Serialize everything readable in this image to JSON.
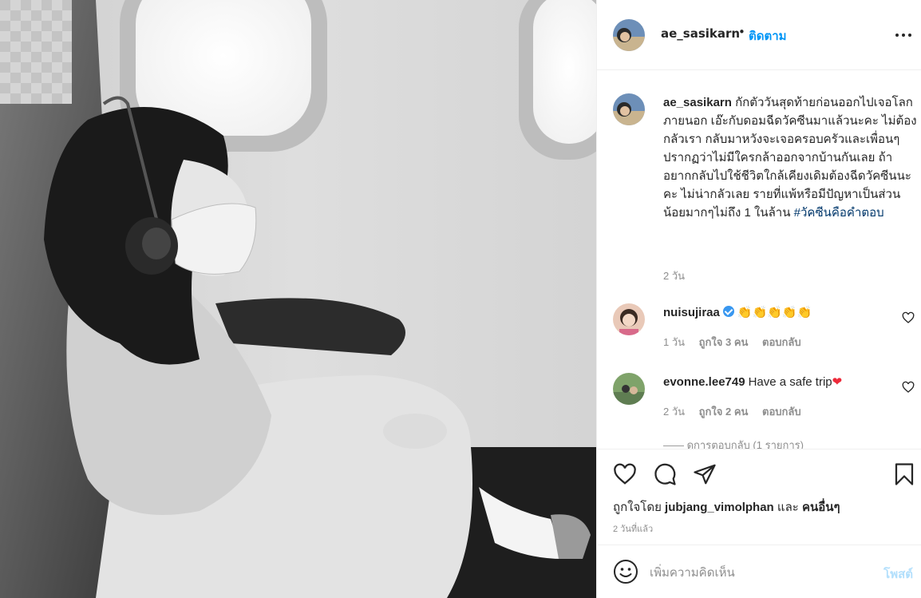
{
  "post": {
    "photo_icon": "airplane-photo",
    "author": {
      "username": "ae_sasikarn",
      "follow_label": "ติดตาม",
      "separator": "•"
    },
    "caption": {
      "username": "ae_sasikarn",
      "text": "กักตัววันสุดท้ายก่อนออกไปเจอโลกภายนอก เอ๊ะกับดอมฉีดวัคซีนมาแล้วนะคะ ไม่ต้องกลัวเรา กลับมาหวังจะเจอครอบครัวและเพื่อนๆ ปรากฏว่าไม่มีใครกล้าออกจากบ้านกันเลย ถ้าอยากกลับไปใช้ชีวิตใกล้เคียงเดิมต้องฉีดวัคซีนนะคะ ไม่น่ากลัวเลย รายที่แพ้หรือมีปัญหาเป็นส่วนน้อยมากๆไม่ถึง 1 ในล้าน ",
      "hashtag": "#วัคซีนคือคำตอบ",
      "time": "2 วัน"
    },
    "comments": [
      {
        "username": "nuisujiraa",
        "verified": true,
        "text": "👏👏👏👏👏",
        "time": "1 วัน",
        "likes": "ถูกใจ 3 คน",
        "reply": "ตอบกลับ"
      },
      {
        "username": "evonne.lee749",
        "verified": false,
        "text": "Have a safe trip",
        "emoji": "❤",
        "time": "2 วัน",
        "likes": "ถูกใจ 2 คน",
        "reply": "ตอบกลับ"
      }
    ],
    "view_replies": "—— ดูการตอบกลับ (1 รายการ)",
    "liked_by": {
      "prefix": "ถูกใจโดย",
      "user": "jubjang_vimolphan",
      "joiner": "และ",
      "others": "คนอื่นๆ"
    },
    "post_time": "2 วันที่แล้ว",
    "comment_box": {
      "placeholder": "เพิ่มความคิดเห็น",
      "post_label": "โพสต์"
    }
  },
  "icons": [
    "more-options-icon",
    "heart-icon",
    "comment-icon",
    "share-icon",
    "bookmark-icon",
    "emoji-icon",
    "verified-badge-icon"
  ],
  "colors": {
    "link": "#0095f6",
    "muted": "#8e8e8e",
    "text": "#262626",
    "hashtag": "#00376b",
    "post_disabled": "#b2dffc",
    "verified": "#3897f0"
  }
}
